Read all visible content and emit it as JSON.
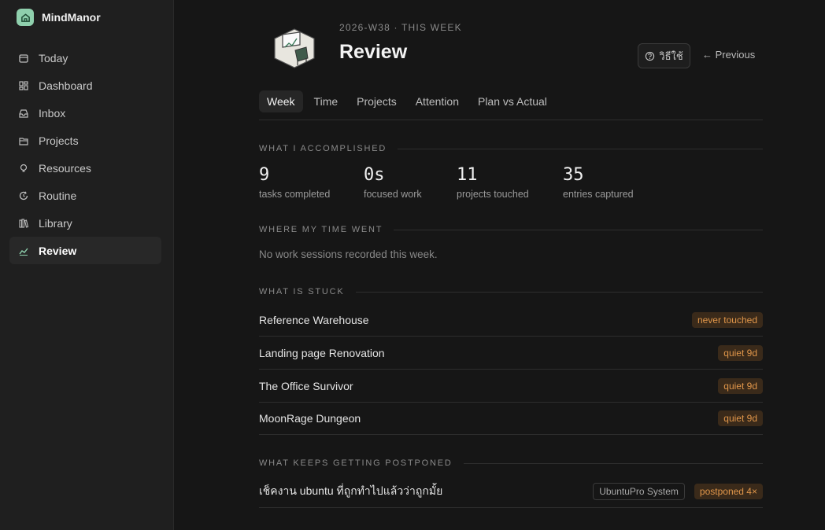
{
  "app": {
    "name": "MindManor"
  },
  "sidebar": {
    "items": [
      {
        "label": "Today",
        "icon": "sun-icon"
      },
      {
        "label": "Dashboard",
        "icon": "grid-icon"
      },
      {
        "label": "Inbox",
        "icon": "inbox-icon"
      },
      {
        "label": "Projects",
        "icon": "folder-icon"
      },
      {
        "label": "Resources",
        "icon": "lightbulb-icon"
      },
      {
        "label": "Routine",
        "icon": "refresh-icon"
      },
      {
        "label": "Library",
        "icon": "books-icon"
      },
      {
        "label": "Review",
        "icon": "trend-line-icon",
        "active": true
      }
    ]
  },
  "header": {
    "week": "2026-W38 · THIS WEEK",
    "title": "Review",
    "help_label": "วิธีใช้",
    "previous_label": "← Previous"
  },
  "tabs": [
    {
      "label": "Week",
      "active": true
    },
    {
      "label": "Time"
    },
    {
      "label": "Projects"
    },
    {
      "label": "Attention"
    },
    {
      "label": "Plan vs Actual"
    }
  ],
  "accomplished": {
    "heading": "WHAT I ACCOMPLISHED",
    "stats": [
      {
        "value": "9",
        "caption": "tasks completed"
      },
      {
        "value": "0s",
        "caption": "focused work"
      },
      {
        "value": "11",
        "caption": "projects touched"
      },
      {
        "value": "35",
        "caption": "entries captured"
      }
    ]
  },
  "time_went": {
    "heading": "WHERE MY TIME WENT",
    "empty_text": "No work sessions recorded this week."
  },
  "stuck": {
    "heading": "WHAT IS STUCK",
    "items": [
      {
        "title": "Reference Warehouse",
        "badge": "never touched"
      },
      {
        "title": "Landing page Renovation",
        "badge": "quiet 9d"
      },
      {
        "title": "The Office Survivor",
        "badge": "quiet 9d"
      },
      {
        "title": "MoonRage Dungeon",
        "badge": "quiet 9d"
      }
    ]
  },
  "postponed": {
    "heading": "WHAT KEEPS GETTING POSTPONED",
    "items": [
      {
        "title": "เช็คงาน ubuntu ที่ถูกทำไปแล้วว่าถูกมั้ย",
        "project": "UbuntuPro System",
        "badge": "postponed 4×"
      }
    ]
  },
  "colors": {
    "accent": "#8fd0ad",
    "badge_text": "#e0964a",
    "badge_bg": "#3a2a1a"
  }
}
